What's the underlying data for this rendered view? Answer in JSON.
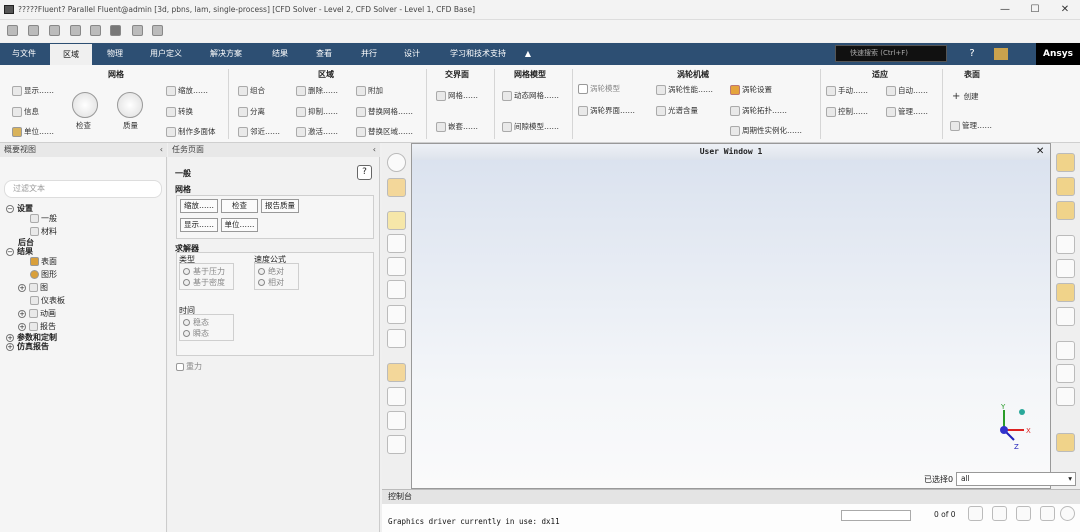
{
  "window": {
    "title": "?????Fluent? Parallel Fluent@admin  [3d, pbns, lam, single-process] [CFD Solver - Level 2, CFD Solver - Level 1, CFD Base]",
    "minimize": "—",
    "maximize": "☐",
    "close": "✕"
  },
  "menu": {
    "file": "与文件",
    "domain": "区域",
    "physics": "物理",
    "user_defined": "用户定义",
    "solution": "解决方案",
    "results": "结果",
    "view": "查看",
    "parallel": "并行",
    "design": "设计",
    "learning": "学习和技术支持",
    "collapse": "▲",
    "search_placeholder": "快速搜索 (Ctrl+F)",
    "help": "?",
    "brand": "Ansys"
  },
  "ribbon": {
    "mesh": {
      "title": "网格",
      "display": "显示……",
      "info": "信息",
      "units": "单位……",
      "check": "检查",
      "quality": "质量",
      "scale": "缩放……",
      "transform": "转换",
      "make_polyhedra": "制作多面体"
    },
    "zones": {
      "title": "区域",
      "combine": "组合",
      "separate": "分离",
      "adjacency": "邻近……",
      "delete": "删除……",
      "deactivate": "抑制……",
      "activate": "激活……",
      "append": "附加",
      "replace_mesh": "替换网格……",
      "replace_zone": "替换区域……"
    },
    "interfaces": {
      "title": "交界面",
      "mesh": "网格……",
      "overset": "嵌套……"
    },
    "mesh_models": {
      "title": "网格模型",
      "dynamic_mesh": "动态网格……",
      "gap_model": "间隙模型……"
    },
    "turbo": {
      "title": "涡轮机械",
      "turbo_model": "涡轮模型",
      "turbo_interface": "涡轮界面……",
      "turbo_perf": "涡轮性能……",
      "spectral": "光谱含量",
      "turbo_setup": "涡轮设置",
      "turbo_topology": "涡轮拓扑……",
      "periodic_instancing": "周期性实例化……"
    },
    "adapt": {
      "title": "适应",
      "manual": "手动……",
      "auto": "自动……",
      "control": "控制……",
      "manage": "管理……"
    },
    "surface": {
      "title": "表面",
      "create": "创建",
      "manage": "管理……"
    }
  },
  "outline": {
    "header": "概要视图",
    "collapse": "‹",
    "filter_placeholder": "过滤文本",
    "setup": "设置",
    "general": "一般",
    "materials": "材料",
    "backend": "后台",
    "results": "结果",
    "surfaces": "表面",
    "graphics": "图形",
    "plots": "图",
    "dashboard": "仪表板",
    "animations": "动画",
    "reports": "报告",
    "params": "参数和定制",
    "sim_reports": "仿真报告"
  },
  "task": {
    "header": "任务页面",
    "collapse": "‹",
    "general": "一般",
    "mesh": "网格",
    "scale": "缩放……",
    "check": "检查",
    "report_quality": "报告质量",
    "display": "显示……",
    "units": "单位……",
    "solver": "求解器",
    "type": "类型",
    "pressure_based": "基于压力",
    "density_based": "基于密度",
    "velocity_form": "速度公式",
    "absolute": "绝对",
    "relative": "相对",
    "time": "时间",
    "steady": "稳态",
    "transient": "瞬态",
    "gravity": "重力",
    "help": "?"
  },
  "graphics": {
    "title": "User Window 1",
    "close": "✕",
    "axis_y": "Y",
    "axis_x": "X",
    "axis_z": "Z"
  },
  "selection": {
    "label": "已选择0",
    "value": "all",
    "count": "0 of 0"
  },
  "console": {
    "header": "控制台",
    "text": "Graphics driver currently in use: dx11"
  }
}
